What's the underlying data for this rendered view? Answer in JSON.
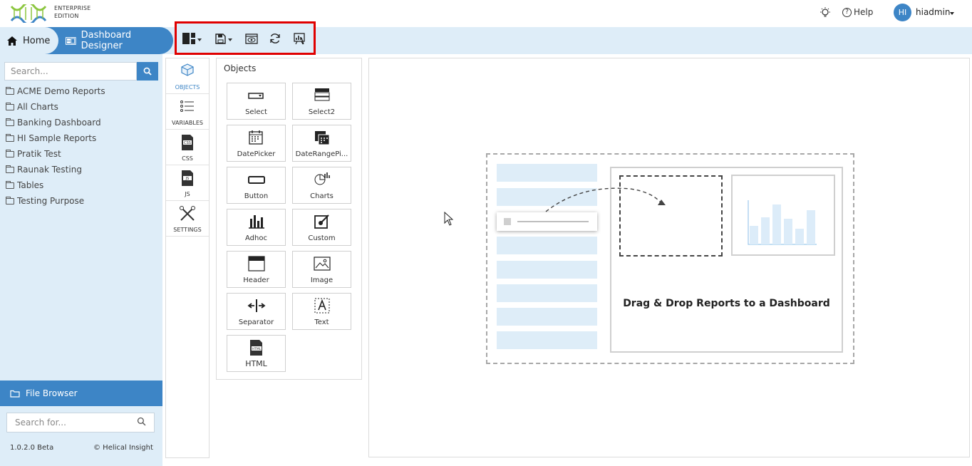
{
  "brand": {
    "edition_line1": "ENTERPRISE",
    "edition_line2": "EDITION"
  },
  "header": {
    "help_label": "Help",
    "avatar_initials": "HI",
    "username": "hiadmin"
  },
  "nav": {
    "home_label": "Home",
    "designer_label": "Dashboard Designer"
  },
  "toolbar": {
    "icons": [
      "layout-icon",
      "save-icon",
      "preview-icon",
      "refresh-icon",
      "report-icon"
    ]
  },
  "sidebar": {
    "search_placeholder": "Search...",
    "folders": [
      "ACME Demo Reports",
      "All Charts",
      "Banking Dashboard",
      "HI Sample Reports",
      "Pratik Test",
      "Raunak Testing",
      "Tables",
      "Testing Purpose"
    ],
    "file_browser_label": "File Browser",
    "file_search_placeholder": "Search for...",
    "version": "1.0.2.0 Beta",
    "copyright": "© Helical Insight"
  },
  "vtabs": [
    "OBJECTS",
    "VARIABLES",
    "CSS",
    "JS",
    "SETTINGS"
  ],
  "objects": {
    "title": "Objects",
    "items": [
      "Select",
      "Select2",
      "DatePicker",
      "DateRangePi...",
      "Button",
      "Charts",
      "Adhoc",
      "Custom",
      "Header",
      "Image",
      "Separator",
      "Text",
      "HTML"
    ]
  },
  "canvas": {
    "drop_text": "Drag & Drop Reports to a Dashboard"
  },
  "colors": {
    "accent": "#3d85c6",
    "nav_bg": "#deedf8",
    "highlight": "#e00000"
  }
}
